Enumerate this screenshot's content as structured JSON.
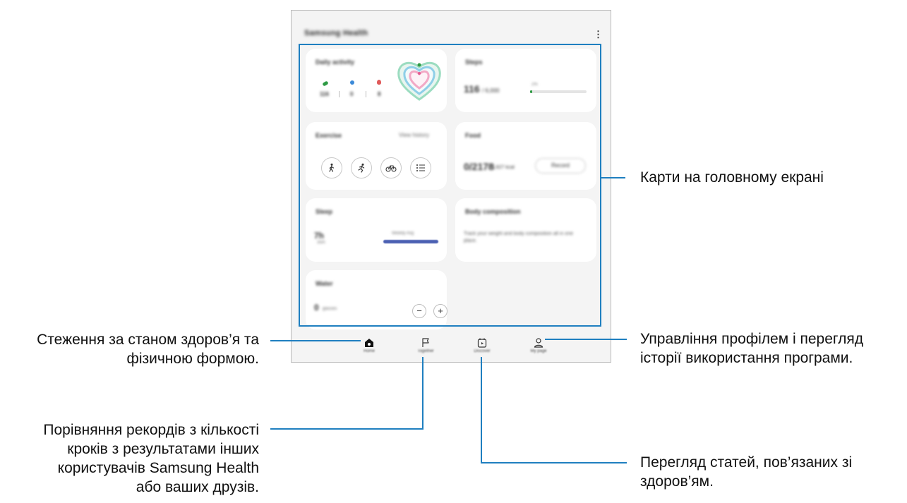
{
  "app": {
    "title": "Samsung Health",
    "more_icon": "more-vert-icon"
  },
  "cards": {
    "daily_activity": {
      "title": "Daily activity",
      "steps": "116",
      "minutes": "0",
      "calories": "8"
    },
    "steps": {
      "title": "Steps",
      "value": "116",
      "goal": "/ 6,000",
      "percent_label": "2%"
    },
    "exercise": {
      "title": "Exercise",
      "link": "View history"
    },
    "food": {
      "title": "Food",
      "value": "0/2178",
      "goal": "/ 1,627 kcal",
      "button": "Record"
    },
    "sleep": {
      "title": "Sleep",
      "value": "7h",
      "unit": "35m",
      "label": "Weekly Avg"
    },
    "body_composition": {
      "title": "Body composition",
      "description": "Track your weight and body composition all in one place."
    },
    "water": {
      "title": "Water",
      "value": "0",
      "unit": "glasses",
      "minus": "−",
      "plus": "+"
    }
  },
  "bottom_nav": [
    {
      "label": "Home",
      "icon": "home-icon"
    },
    {
      "label": "Together",
      "icon": "flag-icon"
    },
    {
      "label": "Discover",
      "icon": "discover-icon"
    },
    {
      "label": "My page",
      "icon": "person-icon"
    }
  ],
  "callouts": {
    "home_cards": "Карти на головному екрані",
    "home_line1": "Стеження за станом здоров’я та",
    "home_line2": "фізичною формою.",
    "together_line1": "Порівняння рекордів з кількості",
    "together_line2": "кроків з результатами інших",
    "together_line3": "користувачів Samsung Health",
    "together_line4": "або ваших друзів.",
    "mypage_line1": "Управління профілем і перегляд",
    "mypage_line2": "історії використання програми.",
    "discover_line1": "Перегляд статей, пов’язаних зі",
    "discover_line2": "здоров’ям."
  },
  "colors": {
    "accent_line": "#1f7fc0",
    "steps_green": "#2e9a44",
    "sleep_bar": "#4a5fb2",
    "heart_green": "#7fd0a8",
    "heart_pink": "#f2a9c6"
  }
}
